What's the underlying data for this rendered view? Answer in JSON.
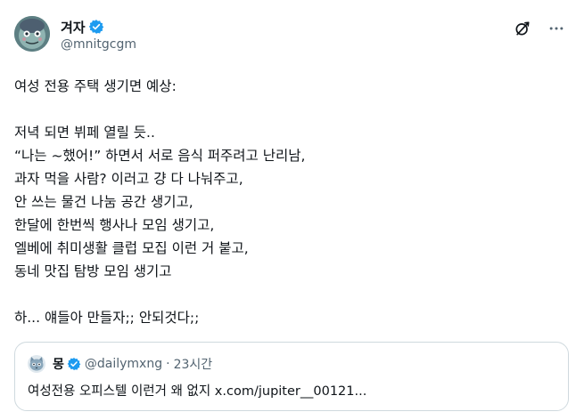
{
  "author": {
    "display_name": "겨자",
    "handle": "@mnitgcgm",
    "avatar_icon": "cartoon-face-avatar",
    "verified_color": "#1d9bf0"
  },
  "header_actions": [
    {
      "name": "grok-icon"
    },
    {
      "name": "more-icon"
    }
  ],
  "body_lines": [
    "여성 전용 주택 생기면 예상:",
    "",
    "저녁 되면 뷔페 열릴 듯..",
    "“나는 ~했어!” 하면서 서로 음식 퍼주려고 난리남,",
    "과자 먹을 사람? 이러고 걍 다 나눠주고,",
    "안 쓰는 물건 나눔 공간 생기고,",
    "한달에 한번씩 행사나 모임 생기고,",
    "엘베에 취미생활 클럽 모집 이런 거 붙고,",
    "동네 맛집 탐방 모임 생기고",
    "",
    "하... 얘들아 만들자;; 안되것다;;"
  ],
  "quote": {
    "display_name": "몽",
    "handle": "@dailymxng",
    "separator": "·",
    "time": "23시간",
    "text": "여성전용 오피스텔 이런거 왜 없지 x.com/jupiter__00121...",
    "avatar_icon": "cat-avatar"
  },
  "colors": {
    "text": "#0f1419",
    "secondary": "#536471",
    "border": "#cfd9de",
    "verified": "#1d9bf0"
  }
}
